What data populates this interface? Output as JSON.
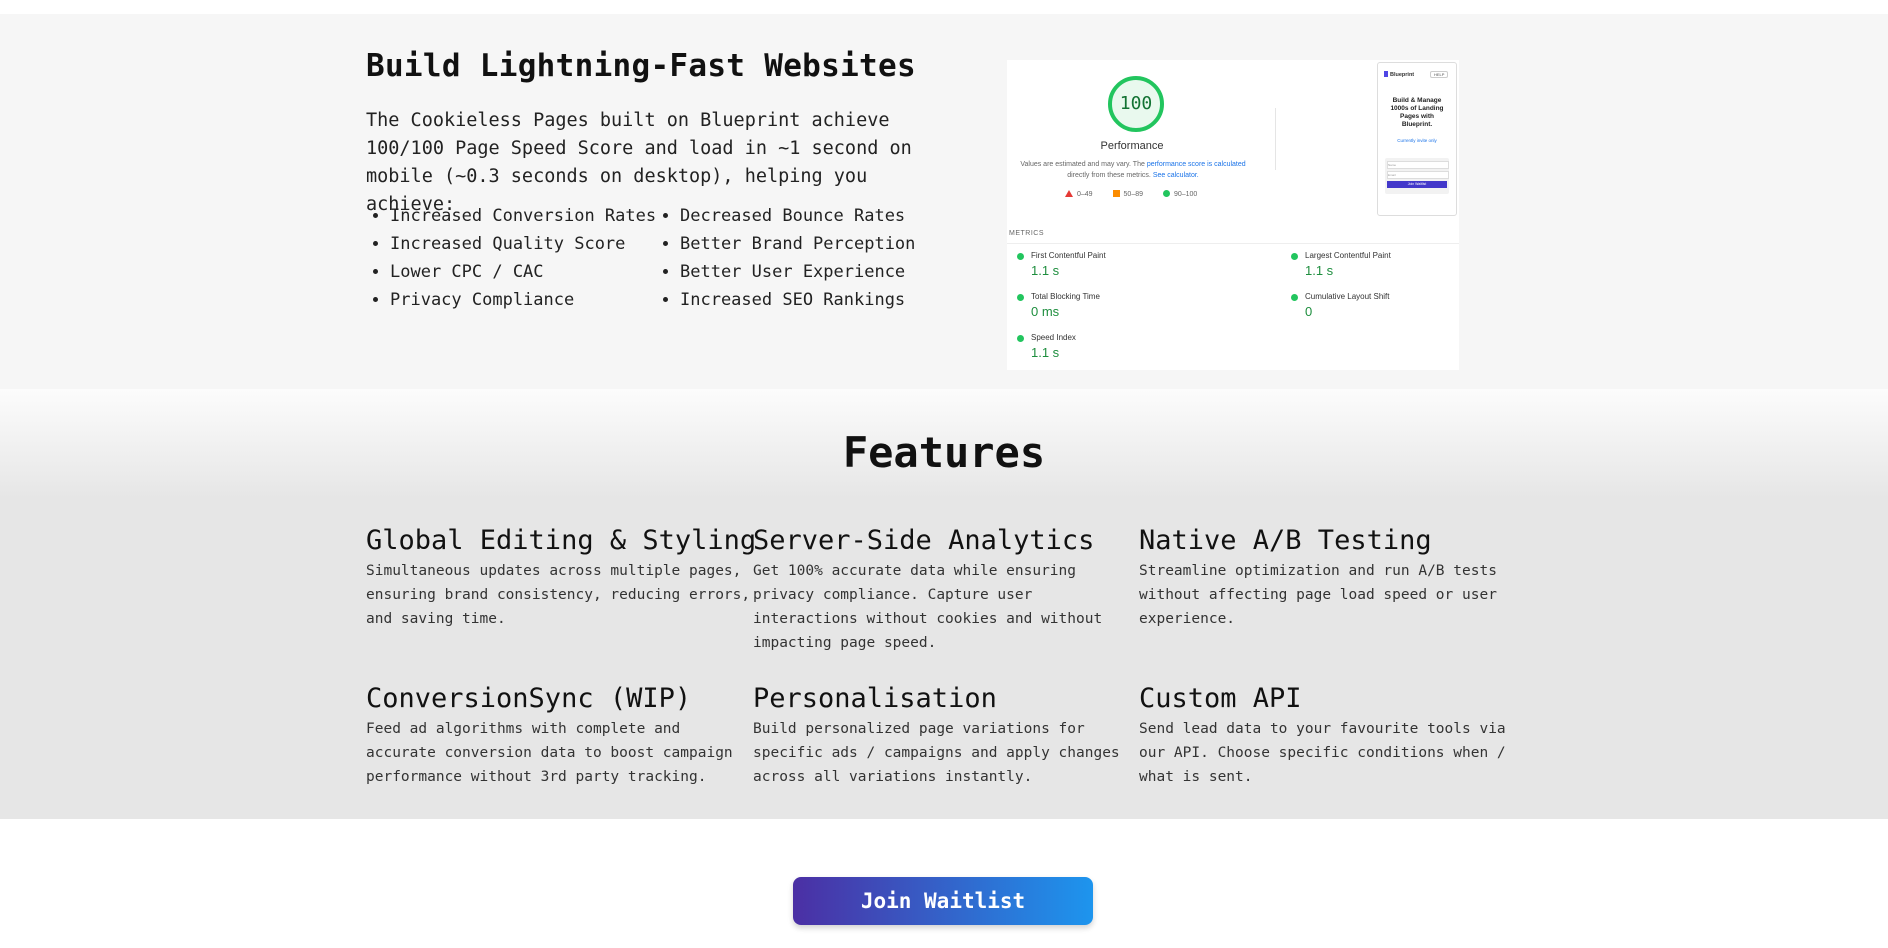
{
  "hero": {
    "title": "Build Lightning-Fast Websites",
    "description": "The Cookieless Pages built on Blueprint achieve 100/100 Page Speed Score and load in ~1 second on mobile (~0.3 seconds on desktop), helping you achieve:",
    "benefits_left": [
      "Increased Conversion Rates",
      "Increased Quality Score",
      "Lower CPC / CAC",
      "Privacy Compliance"
    ],
    "benefits_right": [
      "Decreased Bounce Rates",
      "Better Brand Perception",
      "Better User Experience",
      "Increased SEO Rankings"
    ]
  },
  "report": {
    "score": "100",
    "score_label": "Performance",
    "disclaimer_1": "Values are estimated and may vary. The",
    "disclaimer_link": "performance score is calculated",
    "disclaimer_2": "directly from these metrics.",
    "disclaimer_link_2": "See calculator.",
    "legend": {
      "fail": "0–49",
      "average": "50–89",
      "pass": "90–100"
    },
    "metrics_heading": "METRICS",
    "metrics": [
      {
        "name": "First Contentful Paint",
        "value": "1.1 s"
      },
      {
        "name": "Largest Contentful Paint",
        "value": "1.1 s"
      },
      {
        "name": "Total Blocking Time",
        "value": "0 ms"
      },
      {
        "name": "Cumulative Layout Shift",
        "value": "0"
      },
      {
        "name": "Speed Index",
        "value": "1.1 s"
      }
    ],
    "preview": {
      "brand": "Blueprint",
      "help": "HELP",
      "headline": "Build & Manage 1000s of Landing Pages with Blueprint.",
      "subline": "Currently invite only",
      "input_1": "Name",
      "input_2": "Email",
      "button": "Join Waitlist"
    },
    "colors": {
      "pass": "#22c55e",
      "average": "#fb8c00",
      "fail": "#e53935"
    }
  },
  "features": {
    "title": "Features",
    "items": [
      {
        "title": "Global Editing & Styling",
        "text": "Simultaneous updates across multiple pages, ensuring brand consistency, reducing errors, and saving time."
      },
      {
        "title": "Server-Side Analytics",
        "text": "Get 100% accurate data while ensuring privacy compliance. Capture user interactions without cookies and without impacting page speed."
      },
      {
        "title": "Native A/B Testing",
        "text": "Streamline optimization and run A/B tests without affecting page load speed or user experience."
      },
      {
        "title": "ConversionSync (WIP)",
        "text": "Feed ad algorithms with complete and accurate conversion data to boost campaign performance without 3rd party tracking."
      },
      {
        "title": "Personalisation",
        "text": "Build personalized page variations for specific ads / campaigns and apply changes across all variations instantly."
      },
      {
        "title": "Custom API",
        "text": "Send lead data to your favourite tools via our API. Choose specific conditions when / what is sent."
      }
    ]
  },
  "cta": {
    "label": "Join Waitlist",
    "colors": [
      "#4b2fa4",
      "#1d95ee"
    ]
  }
}
